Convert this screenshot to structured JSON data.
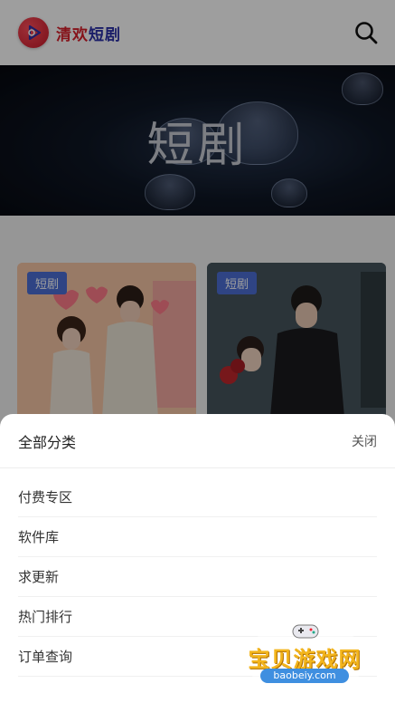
{
  "header": {
    "logo_part1": "清欢",
    "logo_part2": "短剧",
    "search_icon": "search-icon"
  },
  "banner": {
    "title": "短剧"
  },
  "cards": [
    {
      "tag": "短剧"
    },
    {
      "tag": "短剧"
    }
  ],
  "sheet": {
    "title": "全部分类",
    "close_label": "关闭",
    "items": [
      {
        "label": "付费专区"
      },
      {
        "label": "软件库"
      },
      {
        "label": "求更新"
      },
      {
        "label": "热门排行"
      },
      {
        "label": "订单查询"
      }
    ]
  },
  "watermark": {
    "text": "宝贝游戏网",
    "url": "baobeiy.com"
  },
  "colors": {
    "brand_red": "#d81f2b",
    "brand_blue": "#2b2fa8",
    "tag_blue": "#4c6fd6"
  }
}
